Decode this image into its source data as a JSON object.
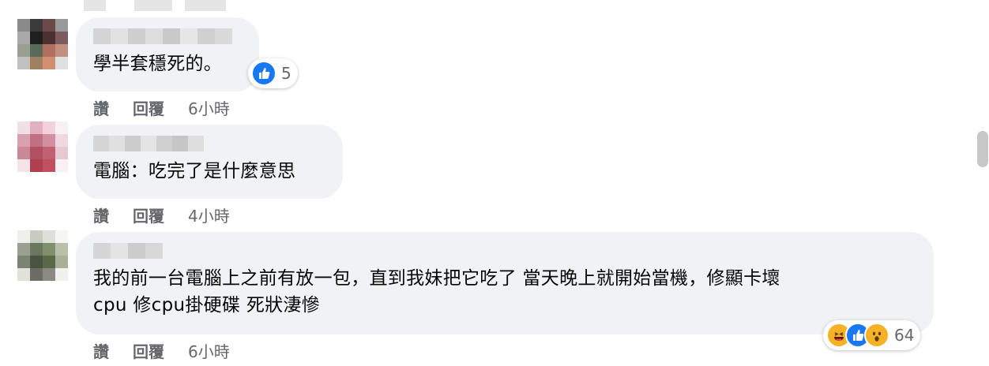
{
  "colors": {
    "like": "#1877f2",
    "haha": "#f7b125",
    "meta_text": "#65676b",
    "bubble": "#f0f2f5"
  },
  "comments": [
    {
      "text": "學半套穩死的。",
      "actions": {
        "like": "讚",
        "reply": "回覆",
        "time": "6小時"
      },
      "reaction": {
        "icons": [
          "like-icon"
        ],
        "count": "5"
      }
    },
    {
      "text": "電腦：吃完了是什麼意思",
      "actions": {
        "like": "讚",
        "reply": "回覆",
        "time": "4小時"
      }
    },
    {
      "text_line1": "我的前一台電腦上之前有放一包，直到我妹把它吃了 當天晚上就開始當機，修顯卡壞",
      "text_line2": "cpu 修cpu掛硬碟 死狀淒慘",
      "actions": {
        "like": "讚",
        "reply": "回覆",
        "time": "6小時"
      },
      "reaction": {
        "icons": [
          "haha-icon",
          "like-icon",
          "wow-icon"
        ],
        "count": "64"
      }
    }
  ]
}
